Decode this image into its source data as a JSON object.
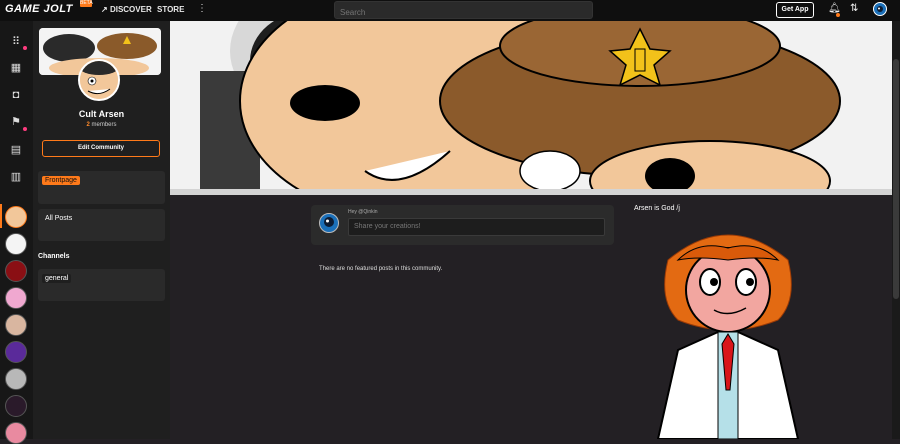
{
  "topbar": {
    "logo": "GAME JOLT",
    "logo_badge": "BETA",
    "discover": "DISCOVER",
    "store": "STORE",
    "more_icon": "more-vertical-icon",
    "search_placeholder": "Search",
    "get_app": "Get App",
    "icons": [
      "bell-icon",
      "activity-icon",
      "avatar"
    ]
  },
  "rail": {
    "icons": [
      "discover-icon",
      "store-icon",
      "backpack-icon",
      "quests-icon",
      "chat-icon",
      "library-icon"
    ]
  },
  "community": {
    "name": "Cult Arsen",
    "members_count": "2",
    "members_label": "members",
    "edit_button": "Edit Community",
    "frontpage": "Frontpage",
    "all_posts": "All Posts",
    "channels_heading": "Channels",
    "channel": "general"
  },
  "feed": {
    "hey_text": "Hey @Qinkin",
    "share_placeholder": "Share your creations!",
    "empty_text": "There are no featured posts in this community."
  },
  "aside": {
    "description": "Arsen is God /j"
  },
  "colors": {
    "accent": "#ff7a1a",
    "background": "#232024",
    "panel": "#2a2a2a"
  }
}
